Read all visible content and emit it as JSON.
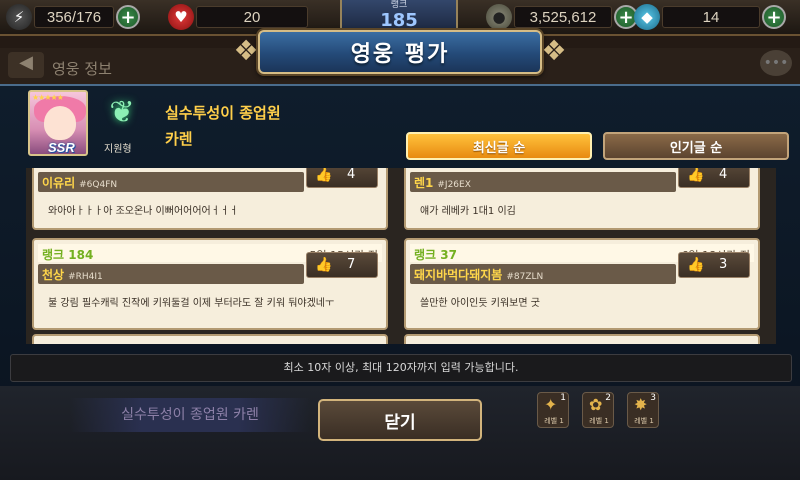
{
  "topbar": {
    "stamina": "356/176",
    "hearts": "20",
    "rank_label": "랭크",
    "rank_value": "185",
    "gold": "3,525,612",
    "gems": "14"
  },
  "background": {
    "sub_title": "영웅 정보",
    "bottom_hero_name": "실수투성이 종업원 카렌",
    "skills": [
      {
        "num": "1",
        "label": "레벨 1"
      },
      {
        "num": "2",
        "label": "레벨 1"
      },
      {
        "num": "3",
        "label": "레벨 1"
      }
    ]
  },
  "modal": {
    "title": "영웅 평가",
    "hero": {
      "title": "실수투성이 종업원",
      "name": "카렌",
      "rarity": "SSR",
      "class_label": "지원형"
    },
    "sort_tabs": [
      {
        "label": "최신글 순",
        "active": true
      },
      {
        "label": "인기글 순",
        "active": false
      }
    ],
    "reviews": [
      {
        "rank": "",
        "time": "",
        "nick": "이유리",
        "tag": "#6Q4FN",
        "likes": "4",
        "text": "와아아ㅏㅏㅏ아 조오온나 이뻐어어어어ㅓㅓㅓ"
      },
      {
        "rank": "",
        "time": "",
        "nick": "렌1",
        "tag": "#J26EX",
        "likes": "4",
        "text": "얘가 레베카 1대1 이김"
      },
      {
        "rank": "랭크 184",
        "time": "5일 15시간 전",
        "nick": "천상",
        "tag": "#RH4I1",
        "likes": "7",
        "text": "불 강림 필수캐릭 진작에 키워둘걸 이제 부터라도 잘 키워 둬야겠네ㅜ"
      },
      {
        "rank": "랭크 37",
        "time": "6일 18시간 전",
        "nick": "돼지바먹다돼지봄",
        "tag": "#87ZLN",
        "likes": "3",
        "text": "쓸만한 아이인듯 키워보면 굿"
      }
    ],
    "hint": "최소 10자 이상, 최대 120자까지 입력 가능합니다.",
    "close_label": "닫기"
  },
  "colors": {
    "accent_orange": "#f0a020",
    "panel_navy": "#0f1d2c",
    "card_cream": "#f6eedc",
    "rank_green": "#74b020",
    "nick_yellow": "#ffd64a"
  },
  "icons": {
    "stamina": "lightning-icon",
    "hearts": "heart-icon",
    "gold": "coin-icon",
    "gems": "gem-icon",
    "like": "thumbs-up-icon"
  }
}
